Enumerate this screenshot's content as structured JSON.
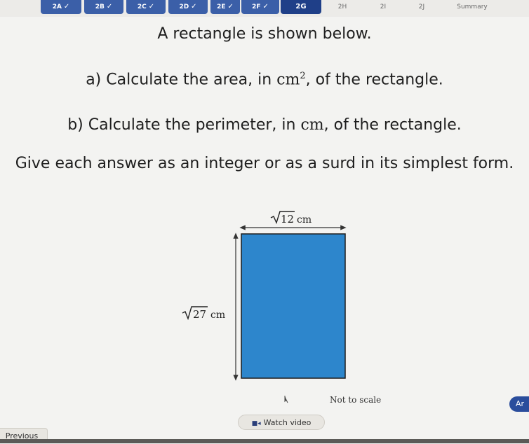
{
  "tabs": [
    {
      "label": "2A",
      "state": "done",
      "checked": true
    },
    {
      "label": "2B",
      "state": "done",
      "checked": true
    },
    {
      "label": "2C",
      "state": "done",
      "checked": true
    },
    {
      "label": "2D",
      "state": "done",
      "checked": true
    },
    {
      "label": "2E",
      "state": "done",
      "checked": true
    },
    {
      "label": "2F",
      "state": "done",
      "checked": true
    },
    {
      "label": "2G",
      "state": "current",
      "checked": false
    },
    {
      "label": "2H",
      "state": "todo",
      "checked": false
    },
    {
      "label": "2I",
      "state": "todo",
      "checked": false
    },
    {
      "label": "2J",
      "state": "todo",
      "checked": false
    },
    {
      "label": "Summary",
      "state": "todo",
      "checked": false
    }
  ],
  "question": {
    "intro": "A rectangle is shown below.",
    "part_a_prefix": "a) Calculate the area, in ",
    "part_a_unit": "cm",
    "part_a_sup": "2",
    "part_a_suffix": ", of the rectangle.",
    "part_b_prefix": "b) Calculate the perimeter, in ",
    "part_b_unit": "cm",
    "part_b_suffix": ", of the rectangle.",
    "instruction": "Give each answer as an integer or as a surd in its simplest form."
  },
  "diagram": {
    "width_radicand": "12",
    "height_radicand": "27",
    "unit": "cm",
    "note": "Not to scale",
    "fill_color": "#2d86cc"
  },
  "buttons": {
    "watch_video": "Watch video",
    "previous": "Previous",
    "answer": "Ar"
  },
  "colors": {
    "tab_done": "#3b5fa8",
    "tab_current": "#1f3f88"
  }
}
